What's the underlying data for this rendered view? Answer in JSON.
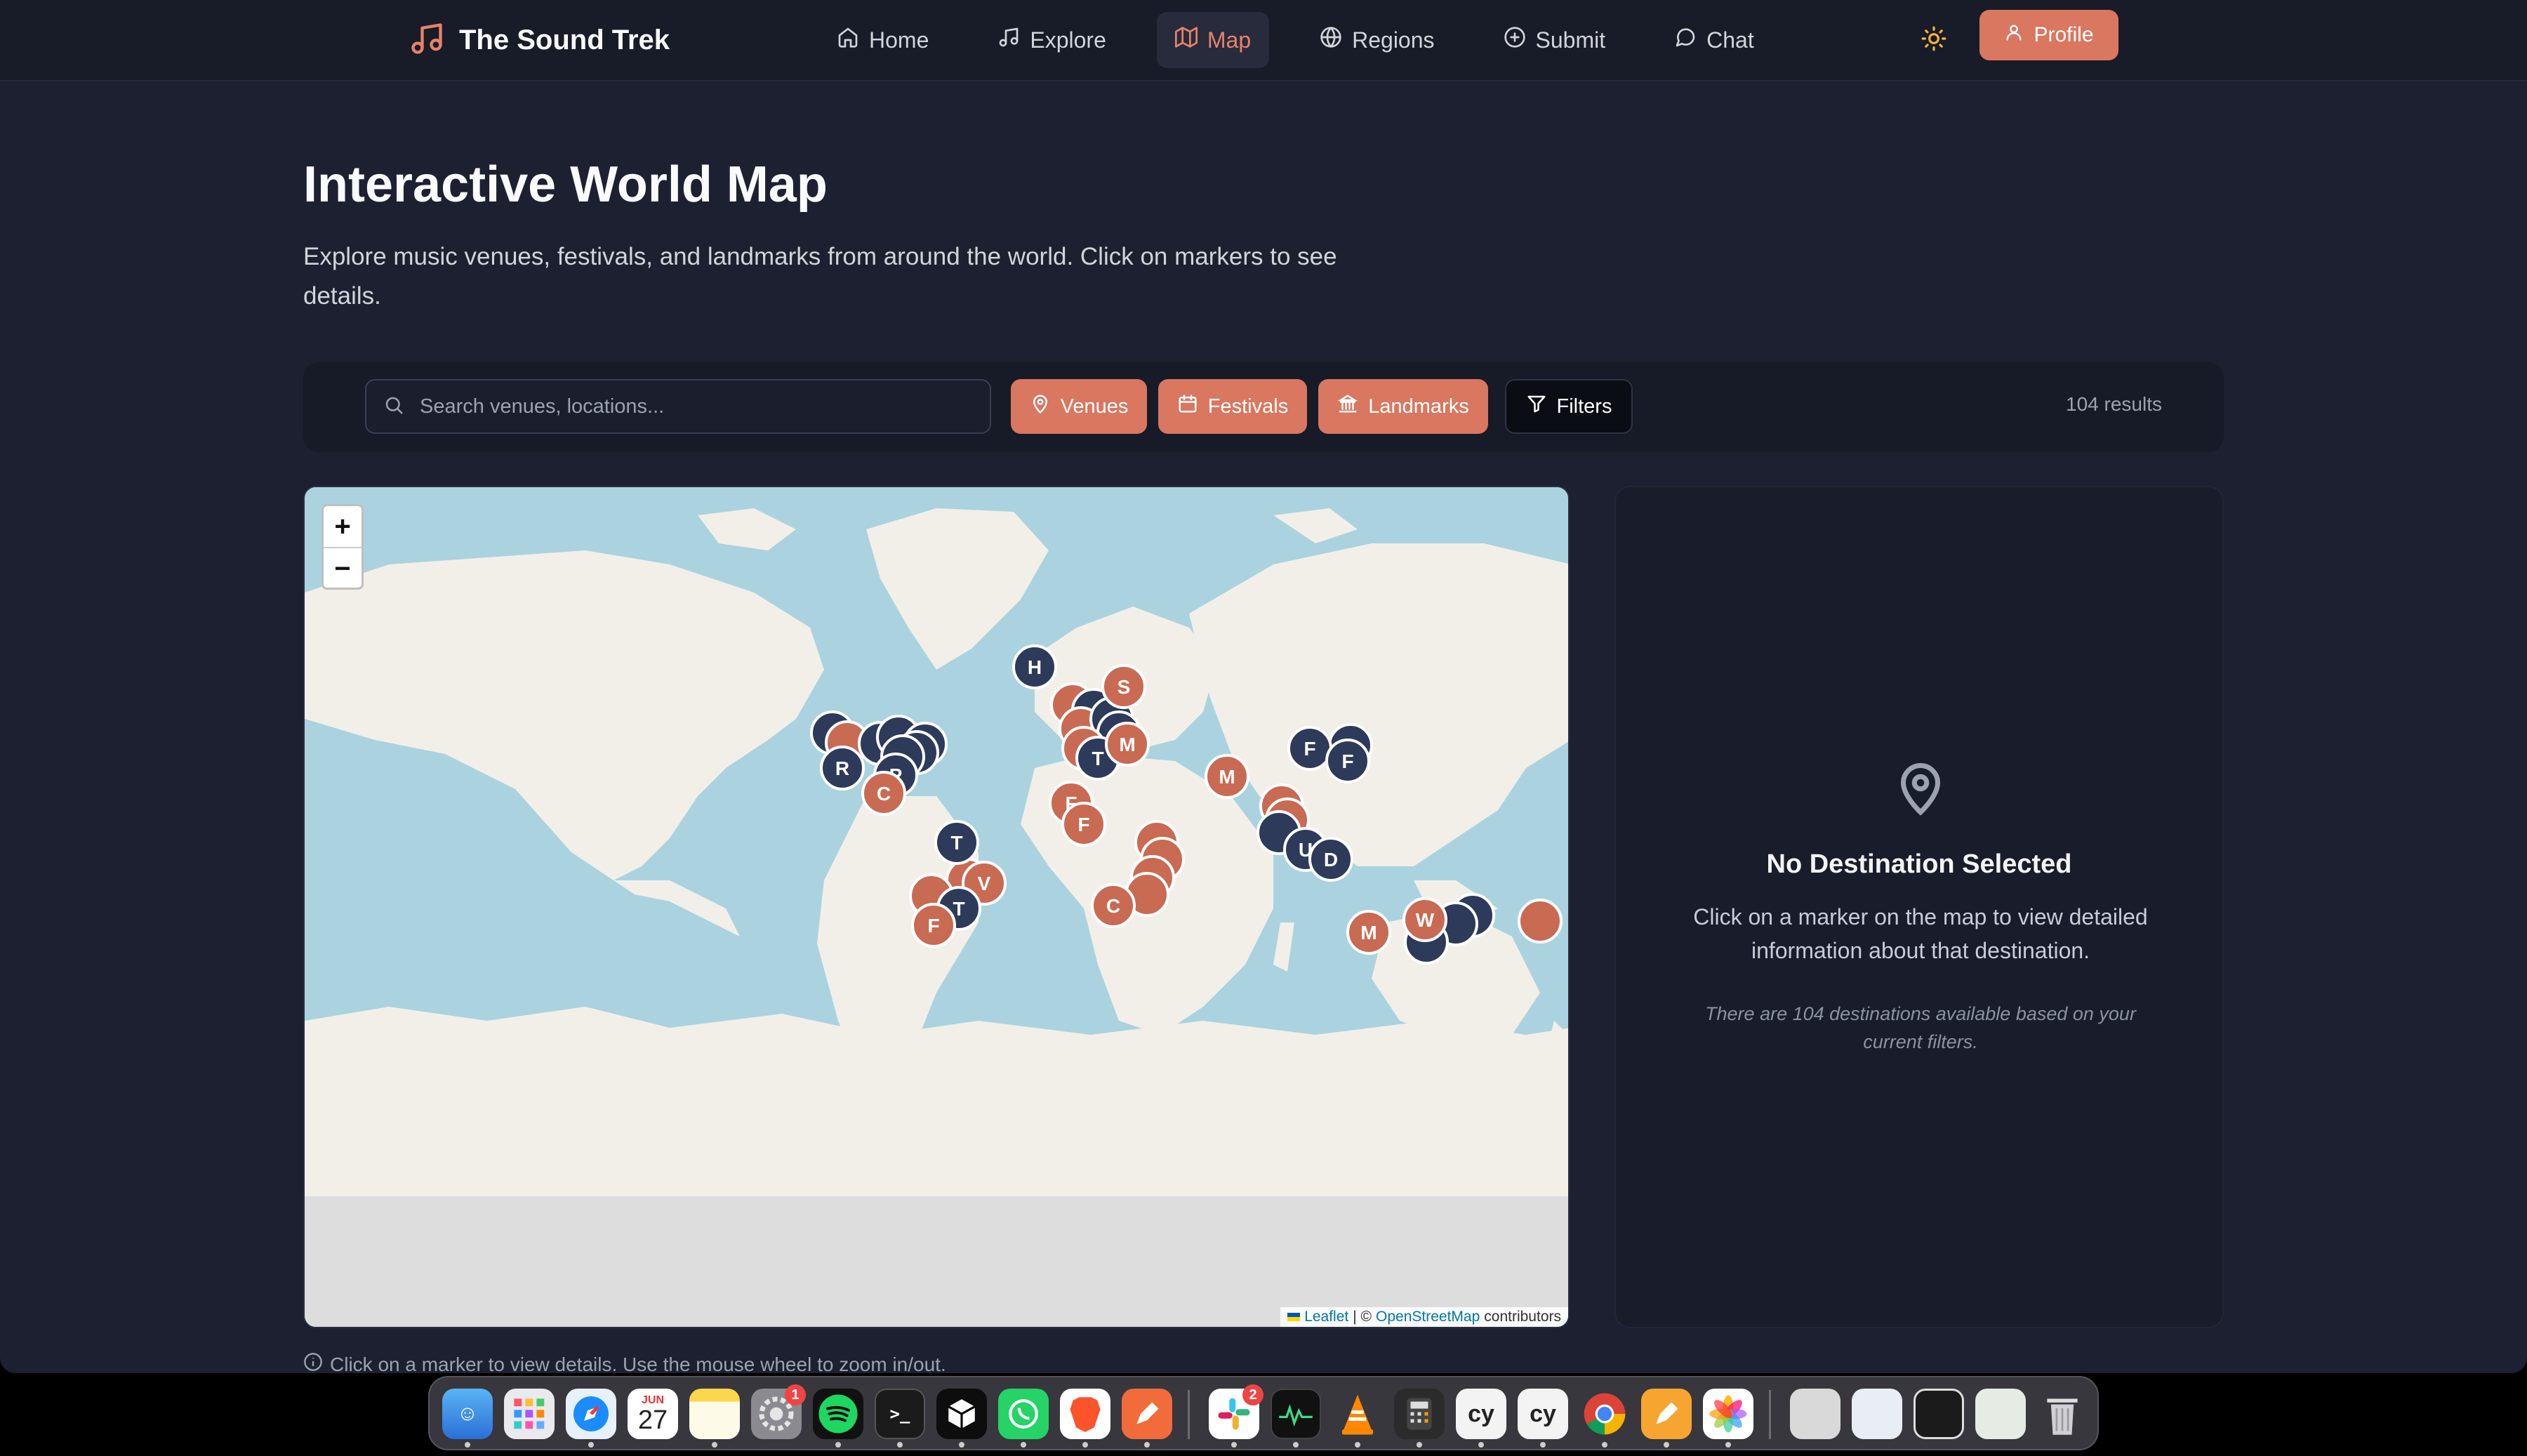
{
  "brand": {
    "title": "The Sound Trek",
    "accent": "#e8836a"
  },
  "nav": {
    "home": "Home",
    "explore": "Explore",
    "map": "Map",
    "regions": "Regions",
    "submit": "Submit",
    "chat": "Chat",
    "profile": "Profile"
  },
  "header": {
    "title": "Interactive World Map",
    "description": "Explore music venues, festivals, and landmarks from around the world. Click on markers to see details."
  },
  "toolbar": {
    "search_placeholder": "Search venues, locations...",
    "venues": "Venues",
    "festivals": "Festivals",
    "landmarks": "Landmarks",
    "filters": "Filters",
    "results": "104 results"
  },
  "map": {
    "zoom_in": "+",
    "zoom_out": "−",
    "attribution_leaflet": "Leaflet",
    "attribution_sep": "| ©",
    "attribution_osm": "OpenStreetMap",
    "attribution_tail": "contributors",
    "markers": [
      {
        "label": "H",
        "kind": "dark"
      },
      {
        "label": "S",
        "kind": "coral"
      },
      {
        "label": "T",
        "kind": "dark"
      },
      {
        "label": "M",
        "kind": "coral"
      },
      {
        "label": "R",
        "kind": "dark"
      },
      {
        "label": "P",
        "kind": "dark"
      },
      {
        "label": "C",
        "kind": "coral"
      },
      {
        "label": "F",
        "kind": "coral"
      },
      {
        "label": "F",
        "kind": "coral"
      },
      {
        "label": "M",
        "kind": "coral"
      },
      {
        "label": "F",
        "kind": "dark"
      },
      {
        "label": "F",
        "kind": "dark"
      },
      {
        "label": "T",
        "kind": "dark"
      },
      {
        "label": "V",
        "kind": "coral"
      },
      {
        "label": "T",
        "kind": "dark"
      },
      {
        "label": "F",
        "kind": "coral"
      },
      {
        "label": "C",
        "kind": "coral"
      },
      {
        "label": "U",
        "kind": "dark"
      },
      {
        "label": "D",
        "kind": "dark"
      },
      {
        "label": "M",
        "kind": "coral"
      },
      {
        "label": "W",
        "kind": "coral"
      }
    ]
  },
  "panel": {
    "title": "No Destination Selected",
    "text": "Click on a marker on the map to view detailed information about that destination.",
    "note": "There are 104 destinations available based on your current filters."
  },
  "hint": "Click on a marker to view details. Use the mouse wheel to zoom in/out.",
  "dock": {
    "calendar_month": "JUN",
    "calendar_day": "27",
    "settings_badge": "1",
    "slack_badge": "2"
  }
}
